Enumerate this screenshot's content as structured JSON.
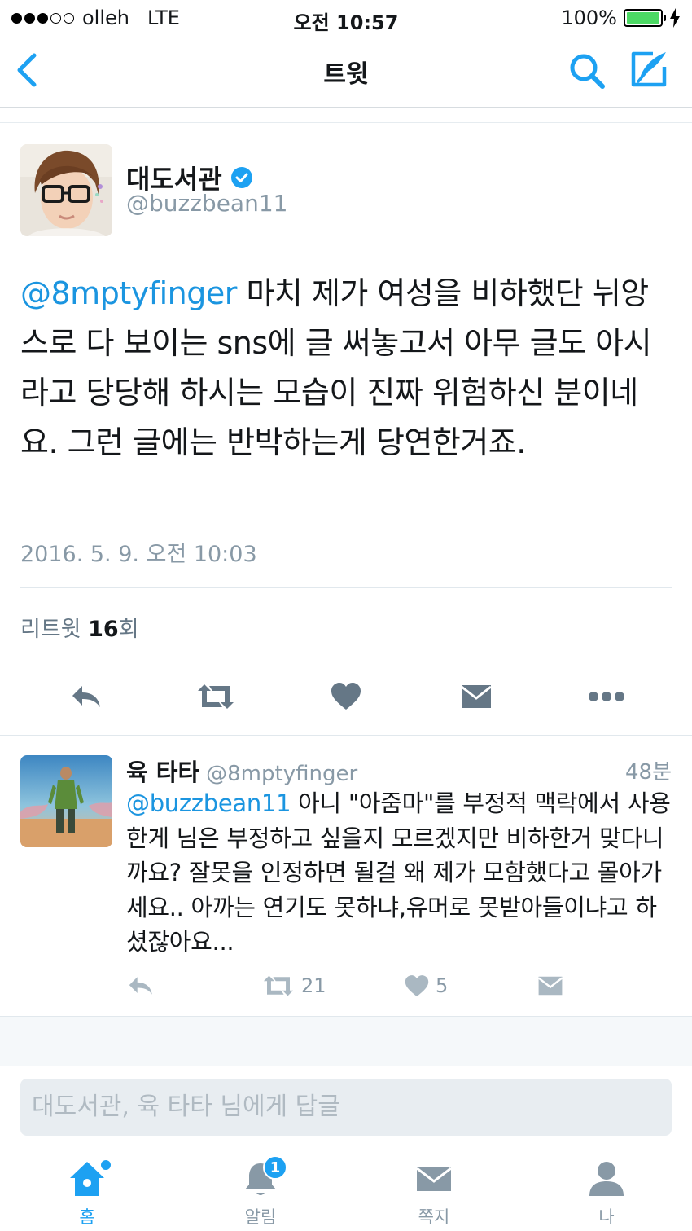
{
  "status_bar": {
    "carrier": "olleh",
    "network": "LTE",
    "time": "오전 10:57",
    "battery": "100%",
    "signal_strength": 3
  },
  "nav": {
    "title": "트윗",
    "back_icon": "chevron-left-icon",
    "search_icon": "search-icon",
    "compose_icon": "compose-icon"
  },
  "tweet": {
    "author_name": "대도서관",
    "author_handle": "@buzzbean11",
    "verified": true,
    "mention": "@8mptyfinger",
    "text": " 마치 제가 여성을 비하했단 뉘앙스로 다 보이는 sns에 글 써놓고서 아무 글도 아시라고 당당해 하시는 모습이 진짜 위험하신 분이네요. 그런 글에는 반박하는게 당연한거죠.",
    "date": "2016. 5. 9. 오전 10:03",
    "retweets_prefix": "리트윗 ",
    "retweets_count": "16",
    "retweets_suffix": "회"
  },
  "reply": {
    "name": "육 타타",
    "handle": "@8mptyfinger",
    "time": "48분",
    "mention": "@buzzbean11",
    "text": " 아니 \"아줌마\"를 부정적 맥락에서 사용한게 님은 부정하고 싶을지 모르겠지만 비하한거 맞다니까요? 잘못을 인정하면 될걸 왜 제가 모함했다고 몰아가세요.. 아까는 연기도 못하냐,유머로 못받아들이냐고 하셨잖아요...",
    "retweets": "21",
    "likes": "5"
  },
  "reply_box": {
    "placeholder": "대도서관, 육 타타 님에게 답글"
  },
  "tabs": [
    {
      "label": "홈",
      "icon": "home-icon"
    },
    {
      "label": "알림",
      "icon": "bell-icon",
      "badge": "1"
    },
    {
      "label": "쪽지",
      "icon": "envelope-icon"
    },
    {
      "label": "나",
      "icon": "person-icon"
    }
  ],
  "colors": {
    "accent": "#1da1f2",
    "mention": "#1b95e0",
    "muted": "#8899a6",
    "battery": "#4cd964"
  }
}
